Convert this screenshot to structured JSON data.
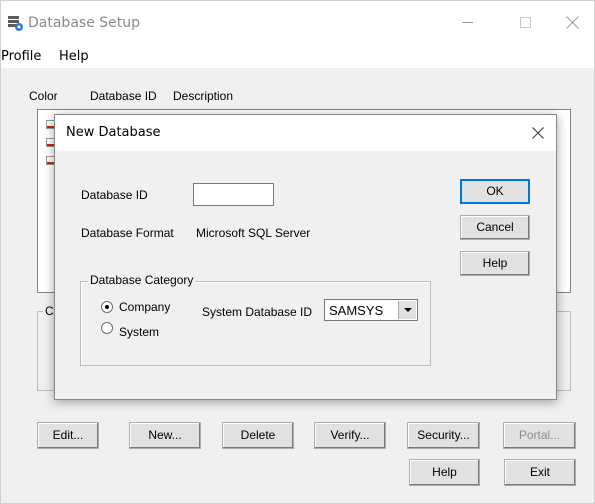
{
  "window": {
    "title": "Database Setup",
    "icon": "database-setup-icon"
  },
  "menu": {
    "items": [
      "Profile",
      "Help"
    ]
  },
  "list": {
    "headers": [
      "Color",
      "Database ID",
      "Description"
    ],
    "swatch_color": "#d21f1f"
  },
  "background_group": {
    "label_fragment": "C"
  },
  "main_buttons": {
    "edit": "Edit...",
    "new": "New...",
    "delete": "Delete",
    "verify": "Verify...",
    "security": "Security...",
    "portal": "Portal...",
    "help": "Help",
    "exit": "Exit"
  },
  "dialog": {
    "title": "New Database",
    "database_id_label": "Database ID",
    "database_id_value": "",
    "database_format_label": "Database Format",
    "database_format_value": "Microsoft SQL Server",
    "buttons": {
      "ok": "OK",
      "cancel": "Cancel",
      "help": "Help"
    },
    "category": {
      "label": "Database Category",
      "options": [
        "Company",
        "System"
      ],
      "selected": "Company",
      "system_db_label": "System Database ID",
      "system_db_value": "SAMSYS"
    }
  }
}
